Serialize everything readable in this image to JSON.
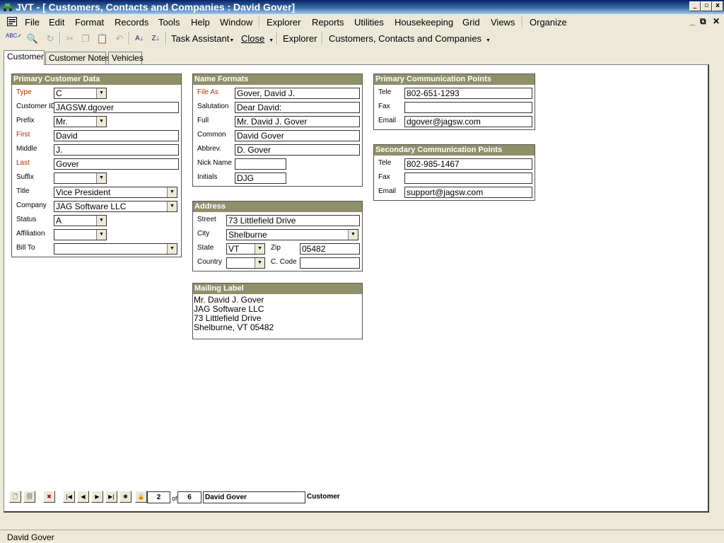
{
  "window": {
    "title": "JVT - [ Customers, Contacts and Companies : David Gover]",
    "min": "_",
    "max": "▫",
    "close": "x"
  },
  "menu": {
    "items": [
      "File",
      "Edit",
      "Format",
      "Records",
      "Tools",
      "Help",
      "Window",
      "Explorer",
      "Reports",
      "Utilities",
      "Housekeeping",
      "Grid",
      "Views",
      "Organize"
    ],
    "mdi_min": "_",
    "mdi_restore": "⧉",
    "mdi_close": "✕"
  },
  "toolbar": {
    "task_assistant": "Task Assistant",
    "close": "Close",
    "explorer": "Explorer",
    "screen_title": "Customers, Contacts and Companies",
    "spell": "ABC✓",
    "find": "🔍",
    "replace": "↻",
    "cut": "✂",
    "copy": "❐",
    "paste": "📋",
    "undo": "↶",
    "sort_asc": "A↓",
    "sort_desc": "Z↓"
  },
  "tabs": [
    "Customer",
    "Customer Notes",
    "Vehicles"
  ],
  "primary_customer_data": {
    "header": "Primary Customer Data",
    "type": {
      "label": "Type",
      "value": "C"
    },
    "customer_id": {
      "label": "Customer ID",
      "value": "JAGSW.dgover"
    },
    "prefix": {
      "label": "Prefix",
      "value": "Mr."
    },
    "first": {
      "label": "First",
      "value": "David"
    },
    "middle": {
      "label": "Middle",
      "value": "J."
    },
    "last": {
      "label": "Last",
      "value": "Gover"
    },
    "suffix": {
      "label": "Suffix",
      "value": ""
    },
    "title": {
      "label": "Title",
      "value": "Vice President"
    },
    "company": {
      "label": "Company",
      "value": "JAG Software LLC"
    },
    "status": {
      "label": "Status",
      "value": "A"
    },
    "affiliation": {
      "label": "Affiliation",
      "value": ""
    },
    "bill_to": {
      "label": "Bill To",
      "value": ""
    }
  },
  "name_formats": {
    "header": "Name Formats",
    "file_as": {
      "label": "File As",
      "value": "Gover, David J."
    },
    "salutation": {
      "label": "Salutation",
      "value": "Dear David:"
    },
    "full": {
      "label": "Full",
      "value": "Mr. David J. Gover"
    },
    "common": {
      "label": "Common",
      "value": "David Gover"
    },
    "abbrev": {
      "label": "Abbrev.",
      "value": "D. Gover"
    },
    "nick_name": {
      "label": "Nick Name",
      "value": ""
    },
    "initials": {
      "label": "Initials",
      "value": "DJG"
    }
  },
  "address": {
    "header": "Address",
    "street": {
      "label": "Street",
      "value": "73 Littlefield Drive"
    },
    "city": {
      "label": "City",
      "value": "Shelburne"
    },
    "state": {
      "label": "State",
      "value": "VT"
    },
    "zip": {
      "label": "Zip",
      "value": "05482"
    },
    "country": {
      "label": "Country",
      "value": ""
    },
    "ccode": {
      "label": "C. Code",
      "value": ""
    }
  },
  "mailing_label": {
    "header": "Mailing Label",
    "lines": [
      "Mr. David J. Gover",
      "JAG Software LLC",
      "73 Littlefield Drive",
      "Shelburne, VT  05482"
    ]
  },
  "primary_comm": {
    "header": "Primary Communication Points",
    "tele": {
      "label": "Tele",
      "value": "802-651-1293"
    },
    "fax": {
      "label": "Fax",
      "value": ""
    },
    "email": {
      "label": "Email",
      "value": "dgover@jagsw.com"
    }
  },
  "secondary_comm": {
    "header": "Secondary Communication Points",
    "tele": {
      "label": "Tele",
      "value": "802-985-1467"
    },
    "fax": {
      "label": "Fax",
      "value": ""
    },
    "email": {
      "label": "Email",
      "value": "support@jagsw.com"
    }
  },
  "navigator": {
    "current": "2",
    "of_label": "of",
    "total": "6",
    "record_name": "David Gover",
    "record_type": "Customer",
    "first": "|◀",
    "prev": "◀",
    "next": "▶",
    "last": "▶|",
    "new": "✱",
    "new_record": "🗋",
    "copy_record": "🗐",
    "delete_record": "✖",
    "lock": "🔒"
  },
  "status_bar": {
    "text": "David Gover"
  }
}
